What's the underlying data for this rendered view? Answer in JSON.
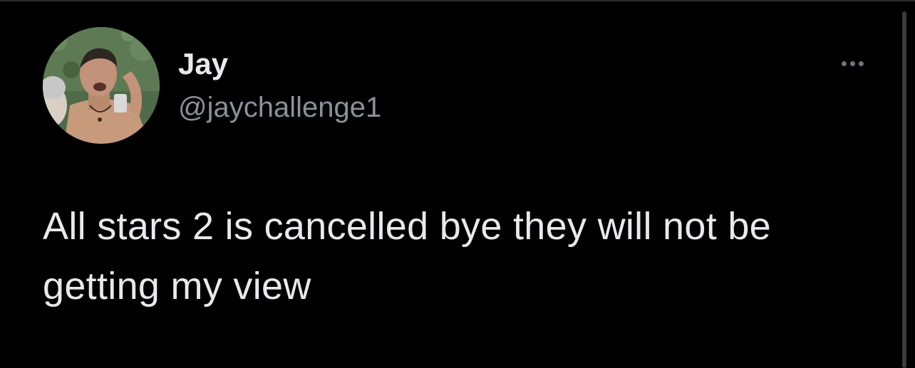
{
  "tweet": {
    "author": {
      "display_name": "Jay",
      "handle": "@jaychallenge1"
    },
    "text": "All stars 2 is cancelled bye they will not be getting my view",
    "more_icon": "more-horizontal-icon"
  },
  "colors": {
    "background": "#000000",
    "primary_text": "#e7e9ea",
    "secondary_text": "#8b9199",
    "icon": "#6e767d"
  }
}
